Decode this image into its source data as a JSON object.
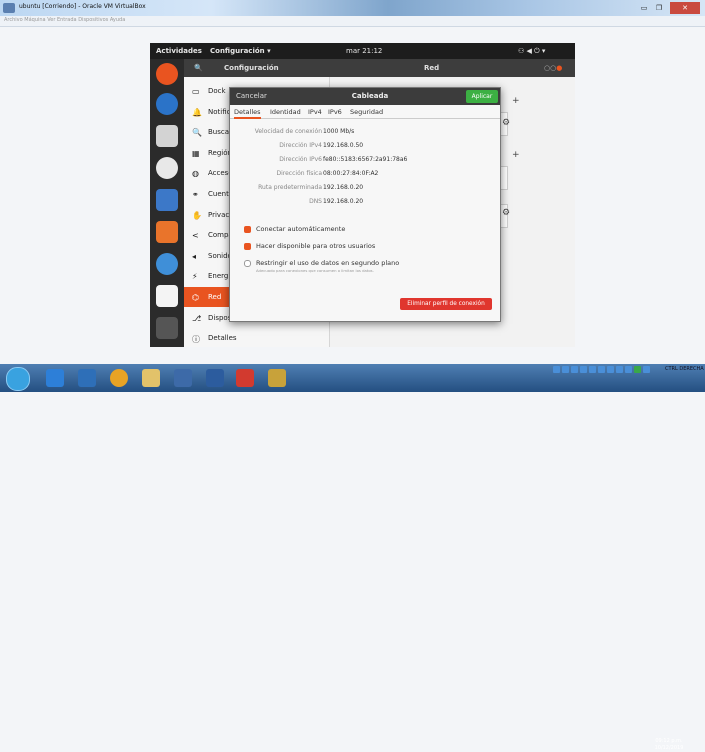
{
  "host": {
    "title": "ubuntu [Corriendo] - Oracle VM VirtualBox",
    "menu": "Archivo  Máquina  Ver  Entrada  Dispositivos  Ayuda"
  },
  "gnome": {
    "activities": "Actividades",
    "app_menu": "Configuración ▾",
    "clock": "mar 21:12"
  },
  "settings": {
    "title": "Configuración",
    "section": "Red",
    "sidebar": [
      {
        "icon": "▭",
        "label": "Dock"
      },
      {
        "icon": "🔔",
        "label": "Notific"
      },
      {
        "icon": "🔍",
        "label": "Buscar"
      },
      {
        "icon": "▦",
        "label": "Región"
      },
      {
        "icon": "◍",
        "label": "Acceso"
      },
      {
        "icon": "⚭",
        "label": "Cuenta"
      },
      {
        "icon": "✋",
        "label": "Privaci"
      },
      {
        "icon": "<",
        "label": "Compa"
      },
      {
        "icon": "◂",
        "label": "Sonido"
      },
      {
        "icon": "⚡",
        "label": "Energí"
      },
      {
        "icon": "⌬",
        "label": "Red"
      },
      {
        "icon": "⎇",
        "label": "Dispos"
      },
      {
        "icon": "ⓘ",
        "label": "Detalles"
      }
    ]
  },
  "dialog": {
    "cancel": "Cancelar",
    "title": "Cableada",
    "apply": "Aplicar",
    "tabs": [
      "Detalles",
      "Identidad",
      "IPv4",
      "IPv6",
      "Seguridad"
    ],
    "rows": [
      {
        "label": "Velocidad de conexión",
        "value": "1000 Mb/s"
      },
      {
        "label": "Dirección IPv4",
        "value": "192.168.0.50"
      },
      {
        "label": "Dirección IPv6",
        "value": "fe80::5183:6567:2a91:78a6"
      },
      {
        "label": "Dirección física",
        "value": "08:00:27:84:0F:A2"
      },
      {
        "label": "Ruta predeterminada",
        "value": "192.168.0.20"
      },
      {
        "label": "DNS",
        "value": "192.168.0.20"
      }
    ],
    "options": [
      {
        "label": "Conectar automáticamente",
        "checked": true
      },
      {
        "label": "Hacer disponible para otros usuarios",
        "checked": true
      },
      {
        "label": "Restringir el uso de datos en segundo plano",
        "checked": false,
        "sub": "Adecuado para conexiones que consumen o limitan los datos."
      }
    ],
    "delete": "Eliminar perfil de conexión"
  },
  "taskbar": {
    "ctrl": "CTRL DERECHA",
    "time": "09:12 p.m.",
    "date": "10/12/2019"
  },
  "colors": {
    "accent": "#e95420",
    "apply": "#3cb043",
    "delete": "#e0362e"
  }
}
